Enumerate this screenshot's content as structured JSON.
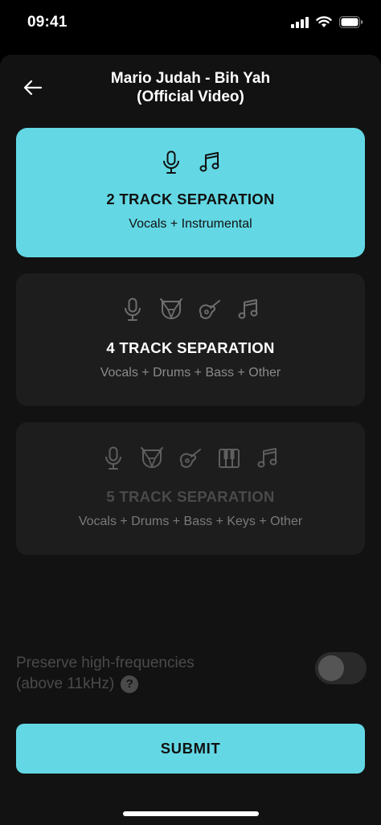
{
  "status_bar": {
    "time": "09:41",
    "icons": [
      "signal-icon",
      "wifi-icon",
      "battery-icon"
    ]
  },
  "header": {
    "title_line1": "Mario Judah - Bih Yah",
    "title_line2": "(Official Video)",
    "back_icon": "back-arrow-icon"
  },
  "options": [
    {
      "title": "2 TRACK SEPARATION",
      "subtitle": "Vocals + Instrumental",
      "icons": [
        "microphone-icon",
        "music-note-icon"
      ],
      "selected": true,
      "enabled": true
    },
    {
      "title": "4 TRACK SEPARATION",
      "subtitle": "Vocals + Drums + Bass + Other",
      "icons": [
        "microphone-icon",
        "drum-icon",
        "guitar-icon",
        "music-note-icon"
      ],
      "selected": false,
      "enabled": true
    },
    {
      "title": "5 TRACK SEPARATION",
      "subtitle": "Vocals + Drums + Bass + Keys + Other",
      "icons": [
        "microphone-icon",
        "drum-icon",
        "guitar-icon",
        "piano-keys-icon",
        "music-note-icon"
      ],
      "selected": false,
      "enabled": false
    }
  ],
  "preference": {
    "label_line1": "Preserve high-frequencies",
    "label_line2": "(above 11kHz)",
    "help_symbol": "?",
    "enabled": false
  },
  "submit": {
    "label": "SUBMIT"
  },
  "colors": {
    "accent": "#63d8e4",
    "background": "#121212",
    "card": "#1d1d1d"
  }
}
